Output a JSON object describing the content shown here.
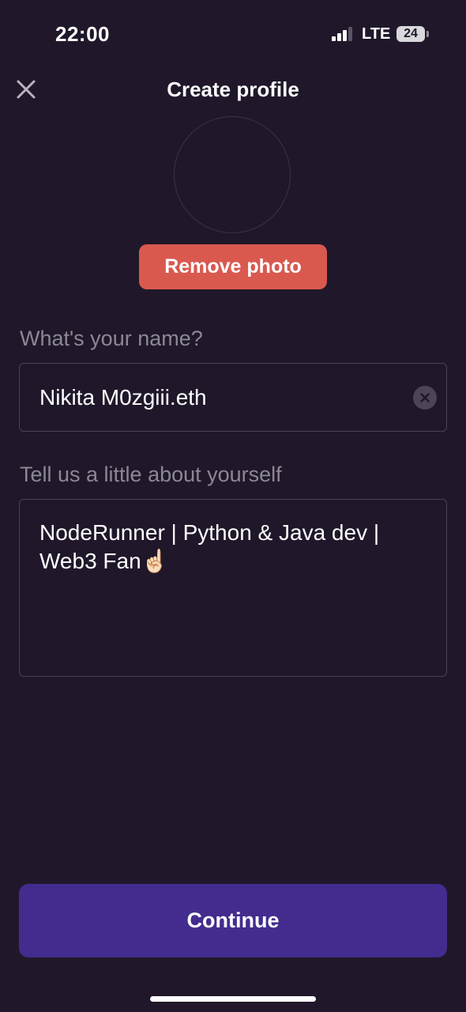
{
  "status_bar": {
    "time": "22:00",
    "network": "LTE",
    "battery": "24",
    "signal_bars_filled": 3,
    "signal_bars_total": 4
  },
  "header": {
    "title": "Create profile",
    "close_icon": "close-icon"
  },
  "profile_photo": {
    "remove_label": "Remove photo"
  },
  "name_field": {
    "label": "What's your name?",
    "value": "Nikita M0zgiii.eth",
    "clear_icon": "clear-circle-icon"
  },
  "bio_field": {
    "label": "Tell us a little about yourself",
    "value": "NodeRunner | Python & Java dev | Web3 Fan☝🏻"
  },
  "actions": {
    "continue_label": "Continue"
  },
  "colors": {
    "background": "#20182a",
    "remove_button": "#d9594f",
    "continue_button": "#432c8e",
    "label_text": "#8c8896",
    "border": "#4a4256"
  }
}
